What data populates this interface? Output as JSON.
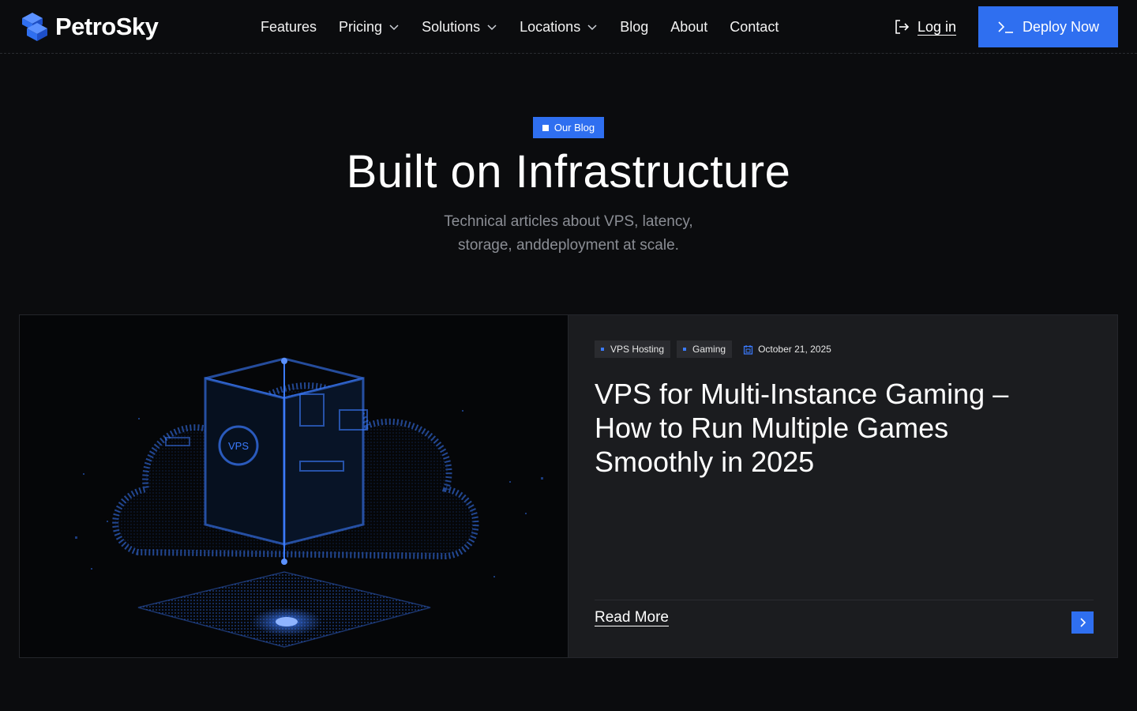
{
  "brand": {
    "name": "PetroSky",
    "accent": "#2f6ff0",
    "background": "#0b0c0e"
  },
  "nav": {
    "items": [
      {
        "label": "Features",
        "dropdown": false
      },
      {
        "label": "Pricing",
        "dropdown": true
      },
      {
        "label": "Solutions",
        "dropdown": true
      },
      {
        "label": "Locations",
        "dropdown": true
      },
      {
        "label": "Blog",
        "dropdown": false
      },
      {
        "label": "About",
        "dropdown": false
      },
      {
        "label": "Contact",
        "dropdown": false
      }
    ],
    "login_label": "Log in",
    "deploy_label": "Deploy Now"
  },
  "hero": {
    "badge": "Our Blog",
    "title": "Built on Infrastructure",
    "subtitle_line1": "Technical articles about VPS, latency,",
    "subtitle_line2": "storage, anddeployment at scale."
  },
  "featured_post": {
    "tags": [
      "VPS Hosting",
      "Gaming"
    ],
    "date": "October 21, 2025",
    "title": "VPS for Multi-Instance Gaming – How to Run Multiple Games Smoothly in 2025",
    "read_more": "Read More",
    "image_icon": "vps-cloud-illustration",
    "image_label": "VPS"
  }
}
